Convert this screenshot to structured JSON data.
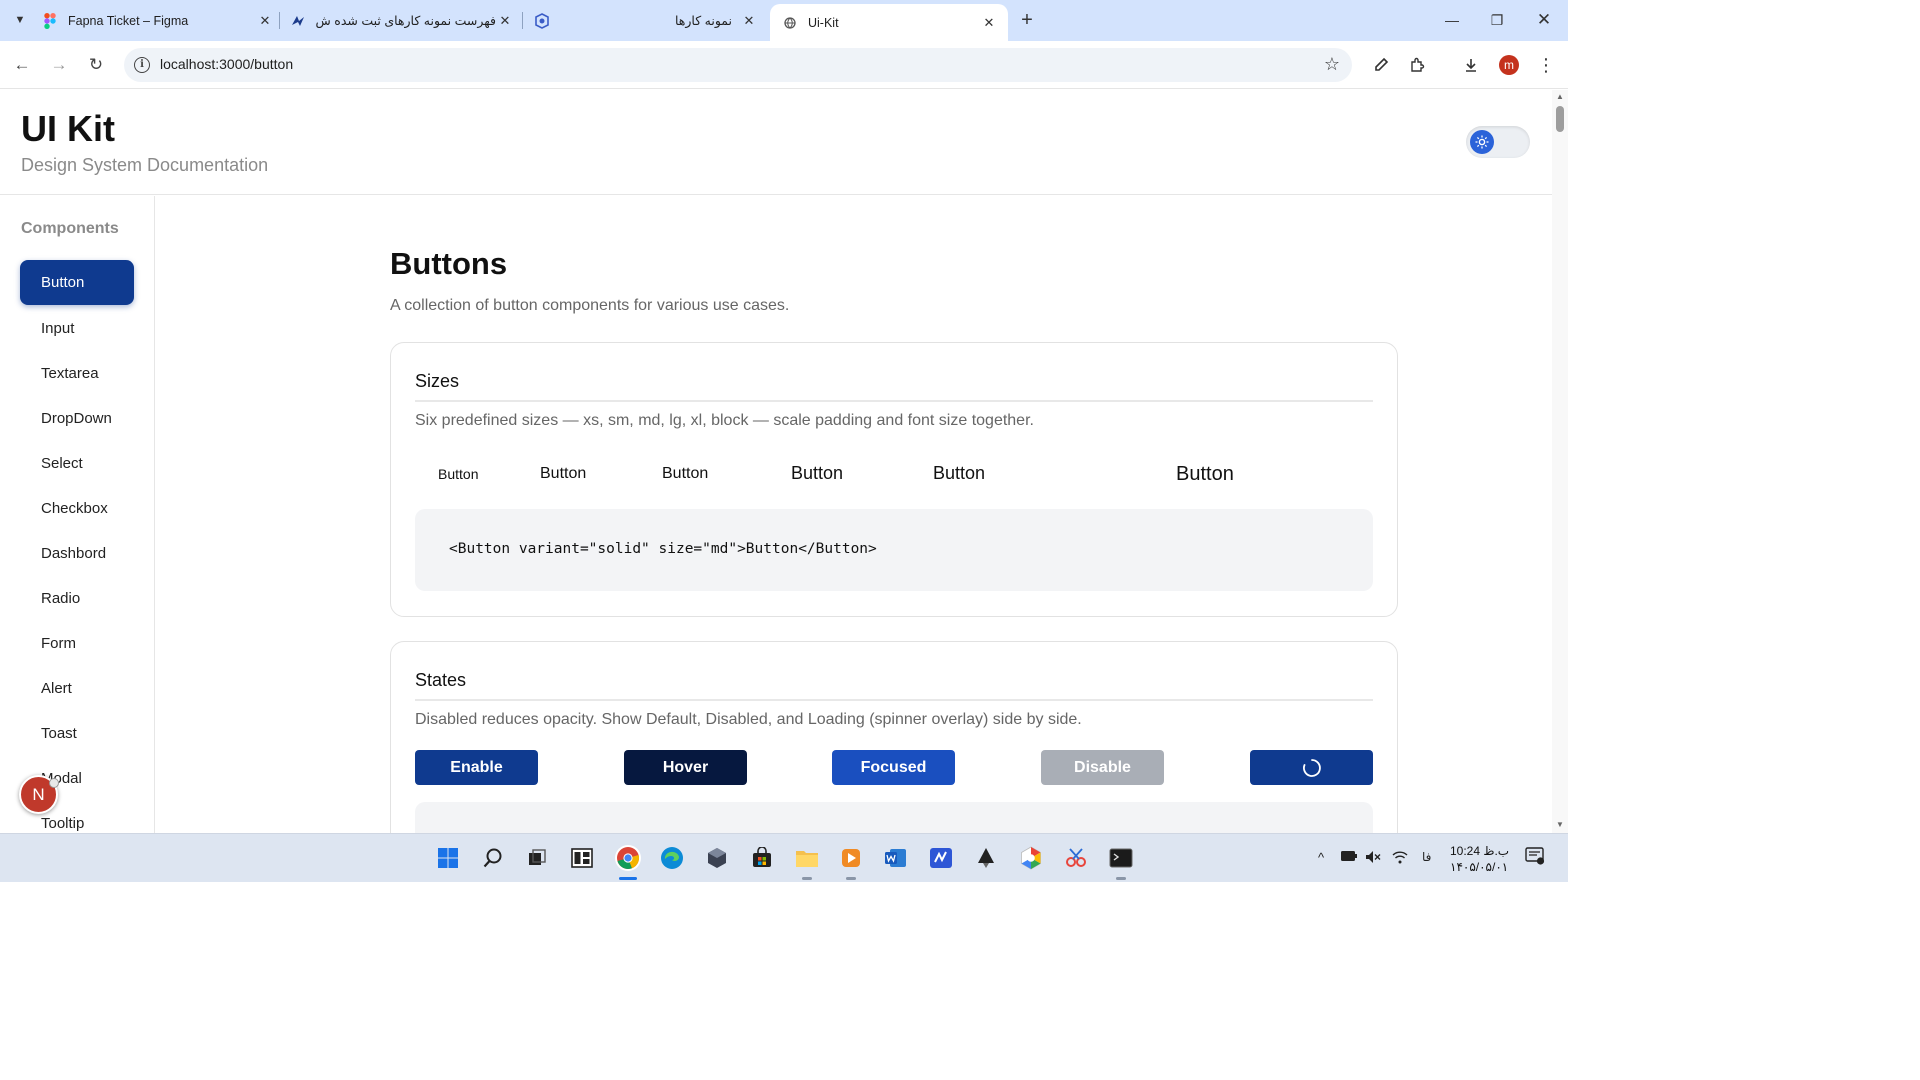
{
  "browser": {
    "tabs": [
      {
        "title": "Fapna Ticket – Figma"
      },
      {
        "title": "فهرست نمونه کارهای ثبت شده ش"
      },
      {
        "title": ""
      },
      {
        "title": "نمونه کارها"
      },
      {
        "title": "Ui-Kit"
      }
    ],
    "url": "localhost:3000/button",
    "profile_initial": "m"
  },
  "header": {
    "title": "UI Kit",
    "subtitle": "Design System Documentation"
  },
  "sidebar": {
    "heading": "Components",
    "items": [
      {
        "label": "Button"
      },
      {
        "label": "Input"
      },
      {
        "label": "Textarea"
      },
      {
        "label": "DropDown"
      },
      {
        "label": "Select"
      },
      {
        "label": "Checkbox"
      },
      {
        "label": "Dashbord"
      },
      {
        "label": "Radio"
      },
      {
        "label": "Form"
      },
      {
        "label": "Alert"
      },
      {
        "label": "Toast"
      },
      {
        "label": "Modal"
      },
      {
        "label": "Tooltip"
      }
    ],
    "fab_label": "N"
  },
  "main": {
    "title": "Buttons",
    "description": "A collection of button components for various use cases.",
    "sizes": {
      "title": "Sizes",
      "description": "Six predefined sizes — xs, sm, md, lg, xl, block — scale padding and font size together.",
      "buttons": [
        "Button",
        "Button",
        "Button",
        "Button",
        "Button",
        "Button"
      ],
      "code": "<Button variant=\"solid\" size=\"md\">Button</Button>"
    },
    "states": {
      "title": "States",
      "description": "Disabled reduces opacity. Show Default, Disabled, and Loading (spinner overlay) side by side.",
      "buttons": [
        "Enable",
        "Hover",
        "Focused",
        "Disable"
      ]
    }
  },
  "colors": {
    "primary": "#0f3a8f",
    "hover": "#06183f",
    "focused": "#1a4fbf",
    "disabled": "#a9aeb6"
  },
  "taskbar": {
    "time": "10:24 ب.ظ",
    "date": "۱۴۰۵/۰۵/۰۱",
    "language": "فا"
  }
}
